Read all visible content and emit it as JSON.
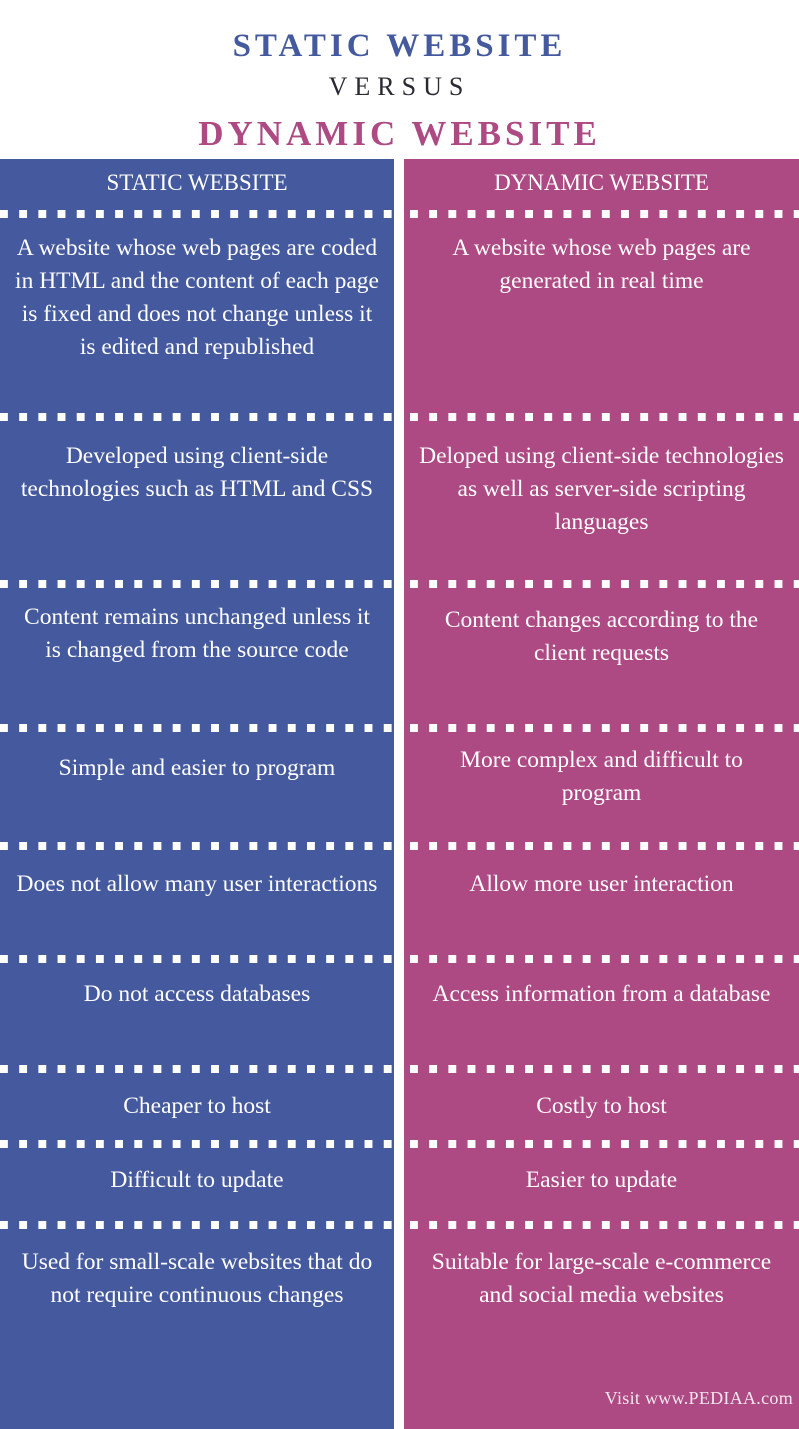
{
  "colors": {
    "static": "#455A9E",
    "dynamic": "#AD4983",
    "versus": "#2a2a33",
    "text_on_column": "#ffffff"
  },
  "title": {
    "top": "STATIC WEBSITE",
    "versus": "VERSUS",
    "bottom": "DYNAMIC WEBSITE"
  },
  "columns": [
    {
      "header": "STATIC WEBSITE",
      "rows": [
        "A website whose web pages are coded in HTML and the content of each page is fixed and does not change unless it is edited and republished",
        "Developed using client-side technologies such as HTML and CSS",
        "Content remains unchanged unless it is changed from the source code",
        "Simple and easier to program",
        "Does not allow many user interactions",
        "Do not access databases",
        "Cheaper to host",
        "Difficult to update",
        "Used for small-scale websites that do not require continuous changes"
      ]
    },
    {
      "header": "DYNAMIC WEBSITE",
      "rows": [
        "A website whose web pages are generated in real time",
        "Deloped using client-side technologies as well as server-side scripting languages",
        "Content changes according to the client requests",
        "More complex and difficult to program",
        "Allow more user interaction",
        "Access information from a database",
        "Costly to host",
        "Easier to update",
        "Suitable for large-scale e-commerce and social media websites"
      ]
    }
  ],
  "footer": "Visit www.PEDIAA.com"
}
